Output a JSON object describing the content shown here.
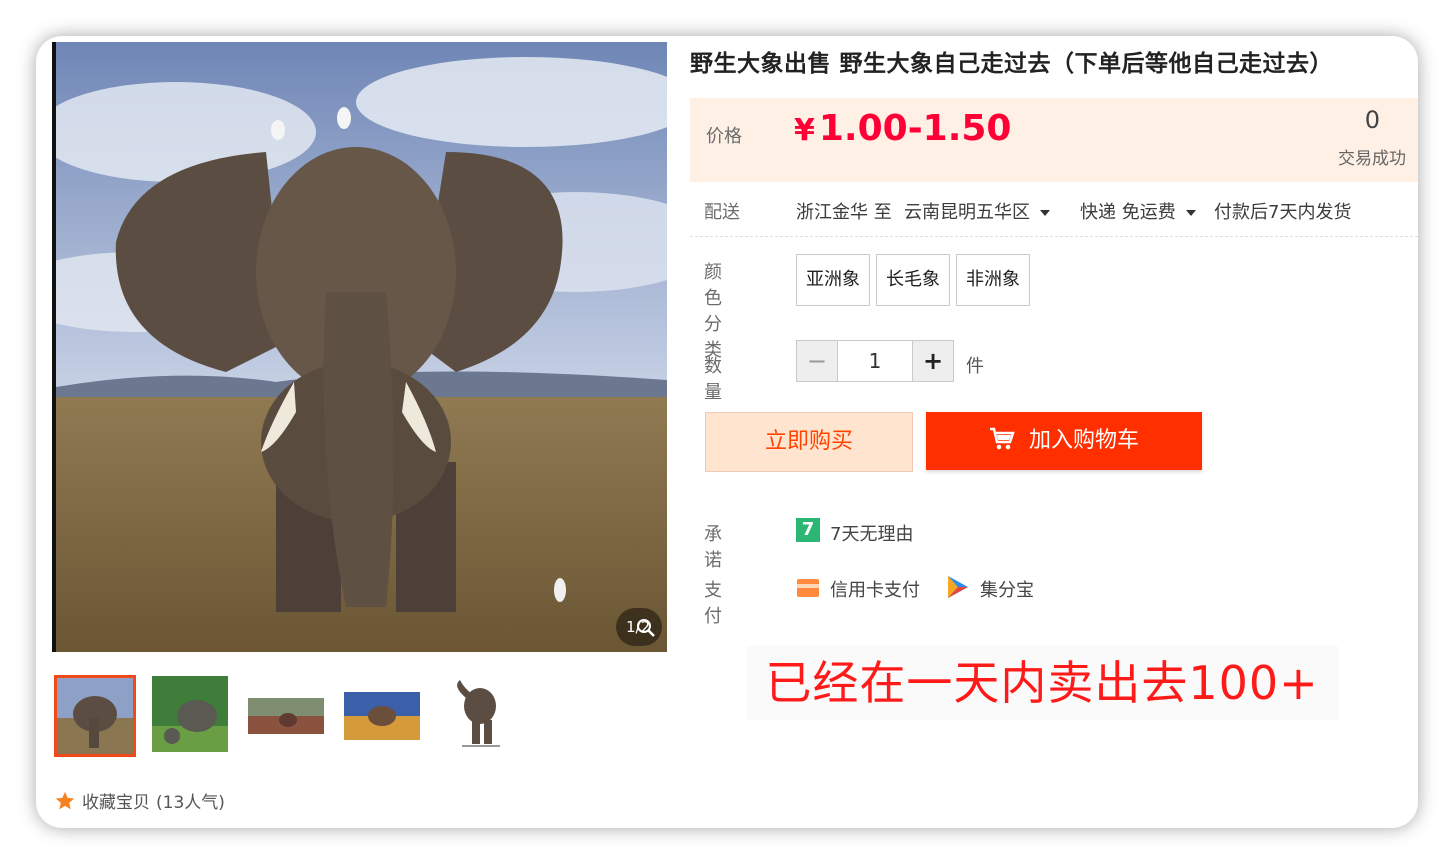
{
  "product": {
    "title": "野生大象出售 野生大象自己走过去（下单后等他自己走过去）",
    "image_counter": "1/2"
  },
  "price": {
    "label": "价格",
    "currency_symbol": "¥",
    "value": "1.00-1.50",
    "sales_count": "0",
    "sales_label": "交易成功"
  },
  "delivery": {
    "label": "配送",
    "from": "浙江金华 至",
    "to": "云南昆明五华区",
    "shipping": "快递 免运费",
    "dispatch": "付款后7天内发货"
  },
  "color": {
    "label": "颜色分类",
    "options": [
      "亚洲象",
      "长毛象",
      "非洲象"
    ]
  },
  "quantity": {
    "label": "数量",
    "value": "1",
    "minus": "−",
    "plus": "+",
    "unit": "件"
  },
  "actions": {
    "buy_now": "立即购买",
    "add_to_cart": "加入购物车"
  },
  "promise": {
    "label": "承诺",
    "badge": "7",
    "text": "7天无理由"
  },
  "payment": {
    "label": "支付",
    "methods": [
      "信用卡支付",
      "集分宝"
    ]
  },
  "favorite": {
    "text": "收藏宝贝",
    "count": "(13人气)"
  },
  "promo_caption": "已经在一天内卖出去100+",
  "colors": {
    "accent_red": "#ff0036",
    "cart_button": "#ff2f00",
    "buy_button_bg": "#ffe4d0",
    "price_bg": "#fff0e6"
  }
}
